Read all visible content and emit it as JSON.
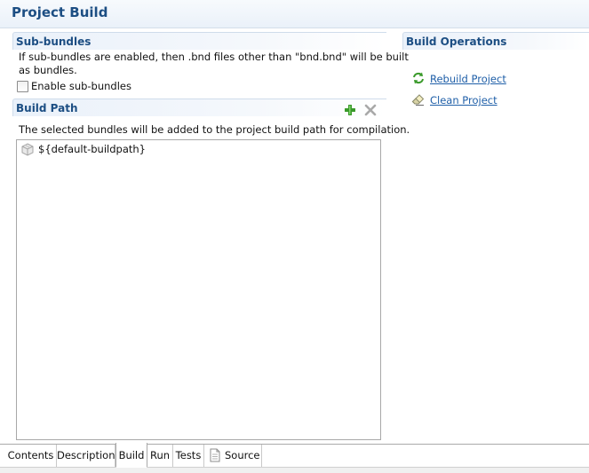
{
  "page": {
    "title": "Project Build"
  },
  "sub_bundles": {
    "title": "Sub-bundles",
    "description_line1": "If sub-bundles are enabled, then .bnd files other than \"bnd.bnd\" will be built",
    "description_line2": "as bundles.",
    "checkbox_label": "Enable sub-bundles",
    "checkbox_checked": false
  },
  "build_path": {
    "title": "Build Path",
    "add_icon": "add-plus-icon",
    "remove_icon": "remove-x-icon",
    "description": "The selected bundles will be added to the project build path for compilation.",
    "items": [
      {
        "label": "${default-buildpath}",
        "icon": "bundle-icon"
      }
    ]
  },
  "build_operations": {
    "title": "Build Operations",
    "actions": [
      {
        "label": "Rebuild Project",
        "icon": "refresh-arrows-icon"
      },
      {
        "label": "Clean Project",
        "icon": "eraser-icon"
      }
    ]
  },
  "tabs": [
    {
      "label": "Contents",
      "active": false
    },
    {
      "label": "Description",
      "active": false
    },
    {
      "label": "Build",
      "active": true
    },
    {
      "label": "Run",
      "active": false
    },
    {
      "label": "Tests",
      "active": false
    },
    {
      "label": "Source",
      "active": false,
      "icon": "document-icon"
    }
  ],
  "colors": {
    "title_blue": "#1c4e83",
    "link_blue": "#1f5fa8",
    "add_green": "#3a9a2a"
  }
}
